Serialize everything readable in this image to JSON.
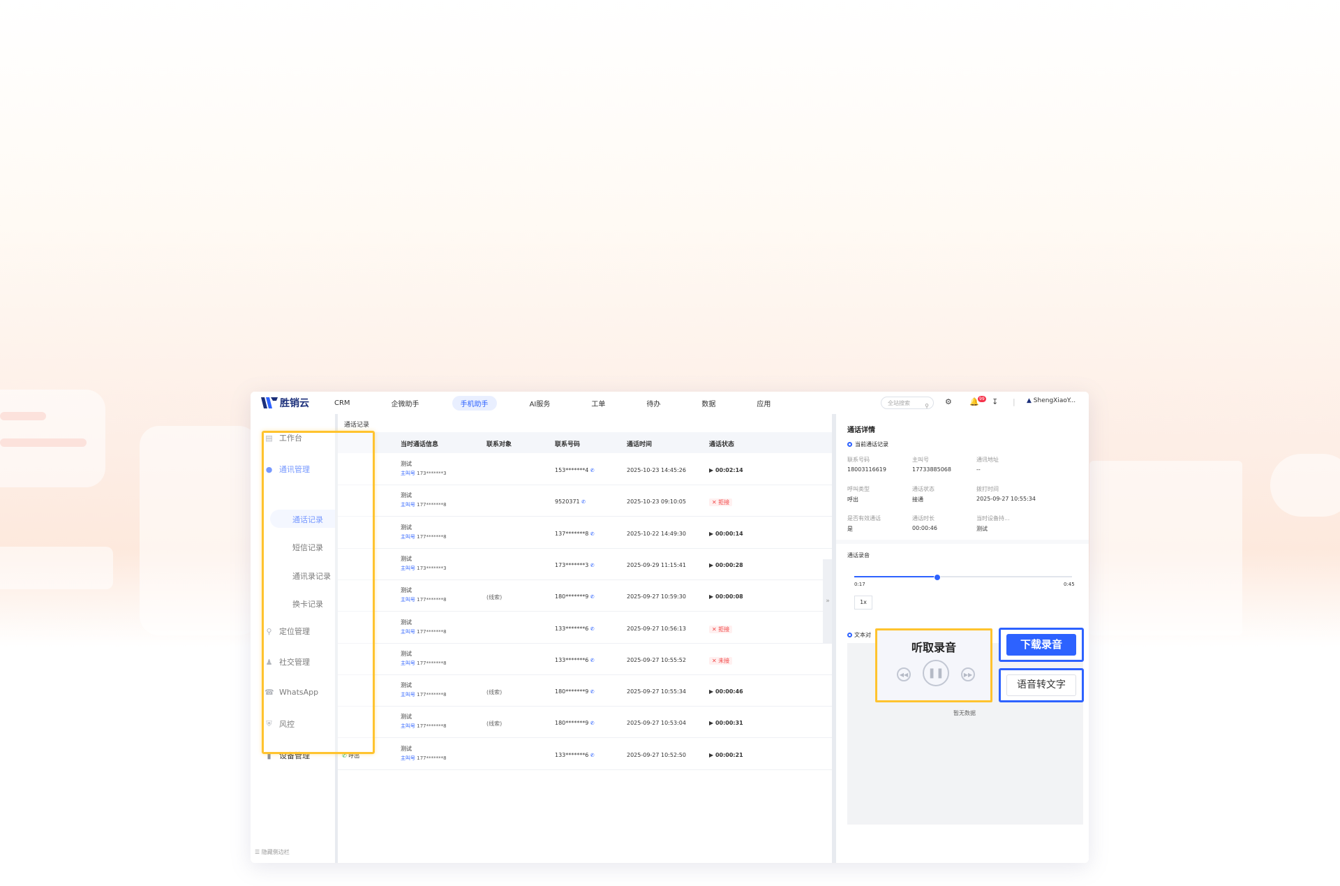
{
  "app": {
    "logo_text": "胜销云",
    "nav": [
      "CRM",
      "企微助手",
      "手机助手",
      "AI服务",
      "工单",
      "待办",
      "数据",
      "应用"
    ],
    "nav_active": "手机助手",
    "search_placeholder": "全站搜索",
    "notification_count": "99",
    "user": "ShengXiaoY..."
  },
  "sidebar": {
    "items": {
      "workbench": "工作台",
      "comm": "通讯管理",
      "location": "定位管理",
      "social": "社交管理",
      "whatsapp": "WhatsApp",
      "risk": "风控",
      "device": "设备管理"
    },
    "sub": {
      "call_records": "通话记录",
      "sms_records": "短信记录",
      "contact_records": "通讯录记录",
      "sim_records": "换卡记录"
    },
    "hide_label": "隐藏侧边栏"
  },
  "table": {
    "breadcrumb": "通话记录",
    "headers": {
      "info": "当时通话信息",
      "obj": "联系对象",
      "num": "联系号码",
      "time": "通话时间",
      "status": "通话状态"
    },
    "rows": [
      {
        "name": "测试",
        "role": "主叫号",
        "caller": "173*******3",
        "obj": "",
        "num": "153*******4",
        "time": "2025-10-23 14:45:26",
        "status": "00:02:14",
        "kind": "play"
      },
      {
        "name": "测试",
        "role": "主叫号",
        "caller": "177*******8",
        "obj": "",
        "num": "9520371",
        "time": "2025-10-23 09:10:05",
        "status": "拒接",
        "kind": "reject"
      },
      {
        "name": "测试",
        "role": "主叫号",
        "caller": "177*******8",
        "obj": "",
        "num": "137*******8",
        "time": "2025-10-22 14:49:30",
        "status": "00:00:14",
        "kind": "play"
      },
      {
        "name": "测试",
        "role": "主叫号",
        "caller": "173*******3",
        "obj": "",
        "num": "173*******3",
        "time": "2025-09-29 11:15:41",
        "status": "00:00:28",
        "kind": "play"
      },
      {
        "name": "测试",
        "role": "主叫号",
        "caller": "177*******8",
        "obj": "(线索)",
        "num": "180*******9",
        "time": "2025-09-27 10:59:30",
        "status": "00:00:08",
        "kind": "play"
      },
      {
        "name": "测试",
        "role": "主叫号",
        "caller": "177*******8",
        "obj": "",
        "num": "133*******6",
        "time": "2025-09-27 10:56:13",
        "status": "拒接",
        "kind": "reject"
      },
      {
        "name": "测试",
        "role": "主叫号",
        "caller": "177*******8",
        "obj": "",
        "num": "133*******6",
        "time": "2025-09-27 10:55:52",
        "status": "未接",
        "kind": "reject"
      },
      {
        "name": "测试",
        "role": "主叫号",
        "caller": "177*******8",
        "obj": "(线索)",
        "num": "180*******9",
        "time": "2025-09-27 10:55:34",
        "status": "00:00:46",
        "kind": "play"
      },
      {
        "name": "测试",
        "role": "主叫号",
        "caller": "177*******8",
        "obj": "(线索)",
        "num": "180*******9",
        "time": "2025-09-27 10:53:04",
        "status": "00:00:31",
        "kind": "play"
      },
      {
        "name": "测试",
        "role": "主叫号",
        "caller": "177*******8",
        "obj": "",
        "num": "133*******6",
        "time": "2025-09-27 10:52:50",
        "status": "00:00:21",
        "kind": "play",
        "dir": "呼出"
      }
    ]
  },
  "detail": {
    "title": "通话详情",
    "current": "当前通话记录",
    "fields": [
      {
        "label": "联系号码",
        "value": "18003116619"
      },
      {
        "label": "主叫号",
        "value": "17733885068"
      },
      {
        "label": "通讯地址",
        "value": "--"
      },
      {
        "label": "呼叫类型",
        "value": "呼出"
      },
      {
        "label": "通话状态",
        "value": "接通"
      },
      {
        "label": "拨打时间",
        "value": "2025-09-27 10:55:34"
      },
      {
        "label": "是否有效通话",
        "value": "是"
      },
      {
        "label": "通话时长",
        "value": "00:00:46"
      },
      {
        "label": "当时设备持...",
        "value": "测试"
      }
    ],
    "recording_title": "通话录音",
    "time_current": "0:17",
    "time_total": "0:45",
    "progress": 0.378,
    "speed": "1x",
    "text_tab": "文本对",
    "empty": "暂无数据"
  },
  "callouts": {
    "listen": "听取录音",
    "download": "下载录音",
    "to_text": "语音转文字"
  }
}
